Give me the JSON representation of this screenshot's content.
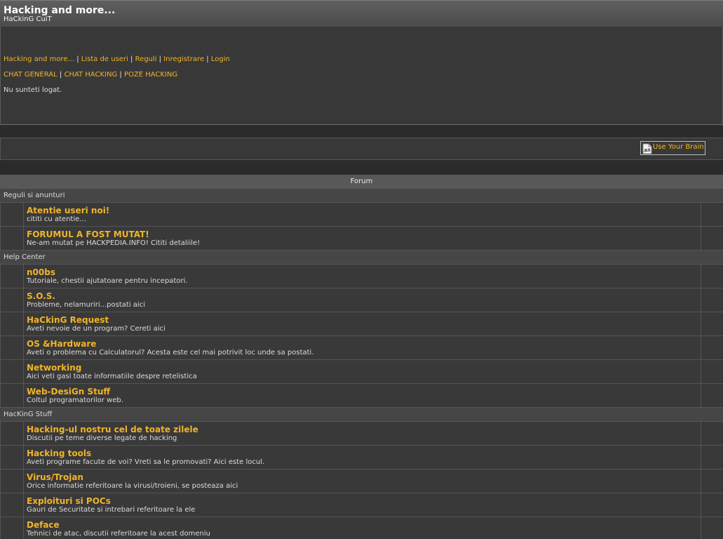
{
  "header": {
    "title": "Hacking and more...",
    "subtitle": "HaCkinG CuiT"
  },
  "nav": {
    "separator": "|",
    "links": [
      "Hacking and more...",
      "Lista de useri",
      "Reguli",
      "Inregistrare",
      "Login"
    ],
    "chat_links": [
      "CHAT GENERAL",
      "CHAT HACKING",
      "POZE HACKING"
    ]
  },
  "status": "Nu sunteti logat.",
  "banner": {
    "alt_text": "Use Your Brain",
    "icon": "broken-image-icon"
  },
  "forum": {
    "header": "Forum",
    "categories": [
      {
        "name": "Reguli si anunturi",
        "forums": [
          {
            "title": "Atentie useri noi!",
            "description": "cititi cu atentie..."
          },
          {
            "title": "FORUMUL A FOST MUTAT!",
            "description": "Ne-am mutat pe HACKPEDIA.INFO! Cititi detaliile!"
          }
        ]
      },
      {
        "name": "Help Center",
        "forums": [
          {
            "title": "n00bs",
            "description": "Tutoriale, chestii ajutatoare pentru incepatori."
          },
          {
            "title": "S.O.S.",
            "description": "Probleme, nelamuriri...postati aici"
          },
          {
            "title": "HaCkinG Request",
            "description": "Aveti nevoie de un program? Cereti aici"
          },
          {
            "title": "OS &Hardware",
            "description": "Aveti o problema cu Calculatorul? Acesta este cel mai potrivit loc unde sa postati."
          },
          {
            "title": "Networking",
            "description": "Aici veti gasi toate informatiile despre retelistica"
          },
          {
            "title": "Web-DesiGn Stuff",
            "description": "Coltul programatorilor web."
          }
        ]
      },
      {
        "name": "HacKinG Stuff",
        "forums": [
          {
            "title": "Hacking-ul nostru cel de toate zilele",
            "description": "Discutii pe teme diverse legate de hacking"
          },
          {
            "title": "Hacking tools",
            "description": "Aveti programe facute de voi? Vreti sa le promovati? Aici este locul."
          },
          {
            "title": "Virus/Trojan",
            "description": "Orice informatie referitoare la virusi/troieni, se posteaza aici"
          },
          {
            "title": "Exploituri si POCs",
            "description": "Gauri de Securitate si intrebari referitoare la ele"
          },
          {
            "title": "Deface",
            "description": "Tehnici de atac, discutii referitoare la acest domeniu"
          }
        ]
      }
    ]
  },
  "colors": {
    "link": "#f0b428",
    "text": "#dcdcdc",
    "page_background": "#2b2b2b",
    "panel_background": "#383838",
    "header_background": "#555555",
    "border": "#555555"
  }
}
